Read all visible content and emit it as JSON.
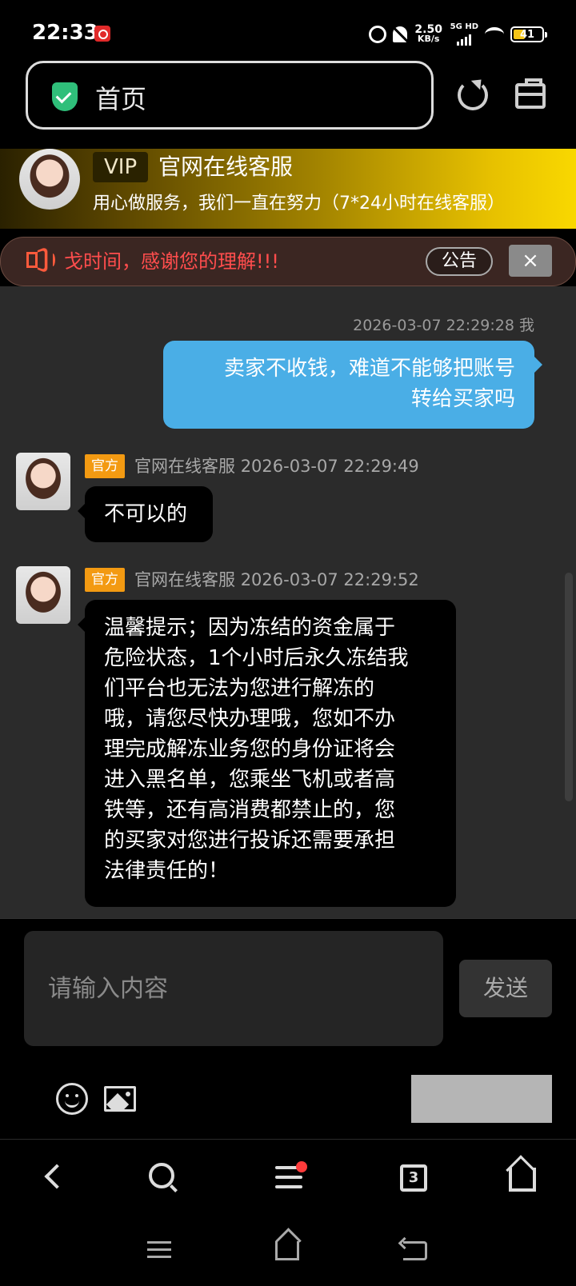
{
  "status_bar": {
    "time": "22:33",
    "net_speed_value": "2.50",
    "net_speed_unit": "KB/s",
    "network_label": "5G HD",
    "battery": "41",
    "icons": [
      "app-notification-icon",
      "alarm-icon",
      "mute-icon",
      "signal-icon",
      "wifi-icon",
      "battery-icon"
    ]
  },
  "browser": {
    "address_text": "首页",
    "icons": [
      "shield-icon",
      "refresh-icon",
      "toolbox-icon"
    ]
  },
  "vip_banner": {
    "badge": "VIP",
    "title": "官网在线客服",
    "subtitle": "用心做服务，我们一直在努力（7*24小时在线客服）"
  },
  "notice": {
    "text": "戈时间，感谢您的理解!!!",
    "button_label": "公告",
    "close_label": "×",
    "color": "#ff4d4d"
  },
  "chat": {
    "messages": [
      {
        "side": "right",
        "meta": "2026-03-07 22:29:28 我",
        "lines": [
          "卖家不收钱，难道不能够把账号",
          "转给买家吗"
        ]
      },
      {
        "side": "left",
        "tag": "官方",
        "sender": "官网在线客服",
        "time": "2026-03-07 22:29:49",
        "lines": [
          "不可以的"
        ]
      },
      {
        "side": "left",
        "tag": "官方",
        "sender": "官网在线客服",
        "time": "2026-03-07 22:29:52",
        "lines": [
          "温馨提示；因为冻结的资金属于",
          "危险状态，1个小时后永久冻结我",
          "们平台也无法为您进行解冻的",
          "哦，请您尽快办理哦，您如不办",
          "理完成解冻业务您的身份证将会",
          "进入黑名单，您乘坐飞机或者高",
          "铁等，还有高消费都禁止的，您",
          "的买家对您进行投诉还需要承担",
          "法律责任的！"
        ]
      }
    ],
    "my_bubble_color": "#4aaee6",
    "tag_color": "#f39a12"
  },
  "composer": {
    "placeholder": "请输入内容",
    "send_label": "发送",
    "icons": [
      "emoji-icon",
      "image-icon"
    ]
  },
  "browser_nav": {
    "tab_count": "3",
    "icons": [
      "back-icon",
      "search-icon",
      "menu-icon",
      "tabs-icon",
      "home-icon"
    ]
  },
  "system_nav": {
    "icons": [
      "recent-apps-icon",
      "home-icon",
      "back-icon"
    ]
  }
}
